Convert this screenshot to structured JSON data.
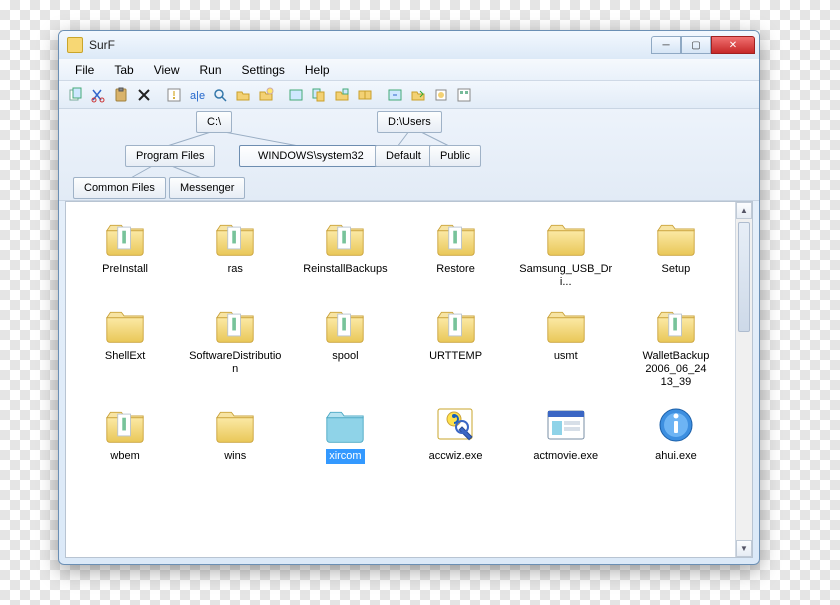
{
  "window": {
    "title": "SurF"
  },
  "menu": {
    "items": [
      "File",
      "Tab",
      "View",
      "Run",
      "Settings",
      "Help"
    ]
  },
  "toolbar_icons": [
    "copy",
    "cut",
    "paste",
    "delete",
    "properties",
    "rename",
    "search",
    "new-folder",
    "new-file",
    "refresh",
    "copy-path",
    "tree",
    "favorites",
    "up",
    "back",
    "forward",
    "views",
    "options"
  ],
  "tabs": {
    "root1": "C:\\",
    "root2": "D:\\Users",
    "level2a": "Program Files",
    "level2b": "WINDOWS\\system32",
    "level2c": "Default",
    "level2d": "Public",
    "level3a": "Common Files",
    "level3b": "Messenger"
  },
  "items": [
    {
      "name": "PreInstall",
      "type": "folder-open"
    },
    {
      "name": "ras",
      "type": "folder-open"
    },
    {
      "name": "ReinstallBackups",
      "type": "folder-open"
    },
    {
      "name": "Restore",
      "type": "folder-open"
    },
    {
      "name": "Samsung_USB_Dri...",
      "type": "folder"
    },
    {
      "name": "Setup",
      "type": "folder"
    },
    {
      "name": "ShellExt",
      "type": "folder"
    },
    {
      "name": "SoftwareDistribution",
      "type": "folder-open"
    },
    {
      "name": "spool",
      "type": "folder-open"
    },
    {
      "name": "URTTEMP",
      "type": "folder-open"
    },
    {
      "name": "usmt",
      "type": "folder"
    },
    {
      "name": "WalletBackup 2006_06_24 13_39",
      "type": "folder-open"
    },
    {
      "name": "wbem",
      "type": "folder-open"
    },
    {
      "name": "wins",
      "type": "folder"
    },
    {
      "name": "xircom",
      "type": "folder-blue",
      "selected": true
    },
    {
      "name": "accwiz.exe",
      "type": "exe-accwiz"
    },
    {
      "name": "actmovie.exe",
      "type": "exe-window"
    },
    {
      "name": "ahui.exe",
      "type": "exe-info"
    }
  ]
}
